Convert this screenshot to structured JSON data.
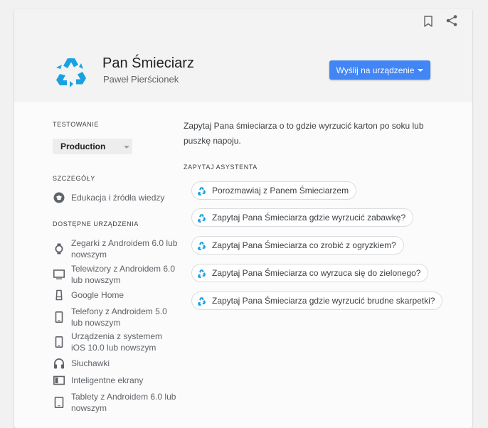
{
  "header": {
    "title": "Pan Śmieciarz",
    "author": "Paweł Pierścionek",
    "send_button": "Wyślij na urządzenie",
    "logo_icon": "recycle-icon",
    "bookmark_icon": "bookmark-icon",
    "share_icon": "share-icon"
  },
  "testing": {
    "label": "TESTOWANIE",
    "selected": "Production"
  },
  "details": {
    "label": "SZCZEGÓŁY",
    "category": "Edukacja i źródła wiedzy"
  },
  "devices": {
    "label": "DOSTĘPNE URZĄDZENIA",
    "items": [
      {
        "icon": "watch-icon",
        "line1": "Zegarki z Androidem 6.0 lub",
        "line2": "nowszym"
      },
      {
        "icon": "tv-icon",
        "line1": "Telewizory z Androidem 6.0",
        "line2": "lub nowszym"
      },
      {
        "icon": "speaker-icon",
        "line1": "Google Home",
        "line2": ""
      },
      {
        "icon": "phone-icon",
        "line1": "Telefony z Androidem 5.0",
        "line2": "lub nowszym"
      },
      {
        "icon": "phone-icon",
        "line1": "Urządzenia z systemem",
        "line2": "iOS 10.0 lub nowszym"
      },
      {
        "icon": "headphones-icon",
        "line1": "Słuchawki",
        "line2": ""
      },
      {
        "icon": "smart-display-icon",
        "line1": "Inteligentne ekrany",
        "line2": ""
      },
      {
        "icon": "tablet-icon",
        "line1": "Tablety z Androidem 6.0 lub",
        "line2": "nowszym"
      }
    ]
  },
  "main": {
    "description": "Zapytaj Pana śmieciarza o to gdzie wyrzucić karton po soku lub puszkę napoju.",
    "ask_label": "ZAPYTAJ ASYSTENTA",
    "suggestions": [
      "Porozmawiaj z Panem Śmieciarzem",
      "Zapytaj Pana Śmieciarza gdzie wyrzucić zabawkę?",
      "Zapytaj Pana Śmieciarza co zrobić z ogryzkiem?",
      "Zapytaj Pana Śmieciarza co wyrzuca się do zielonego?",
      "Zapytaj Pana Śmieciarza gdzie wyrzucić brudne skarpetki?"
    ]
  },
  "colors": {
    "accent": "#4285f4",
    "logo": "#1ba1e2"
  }
}
